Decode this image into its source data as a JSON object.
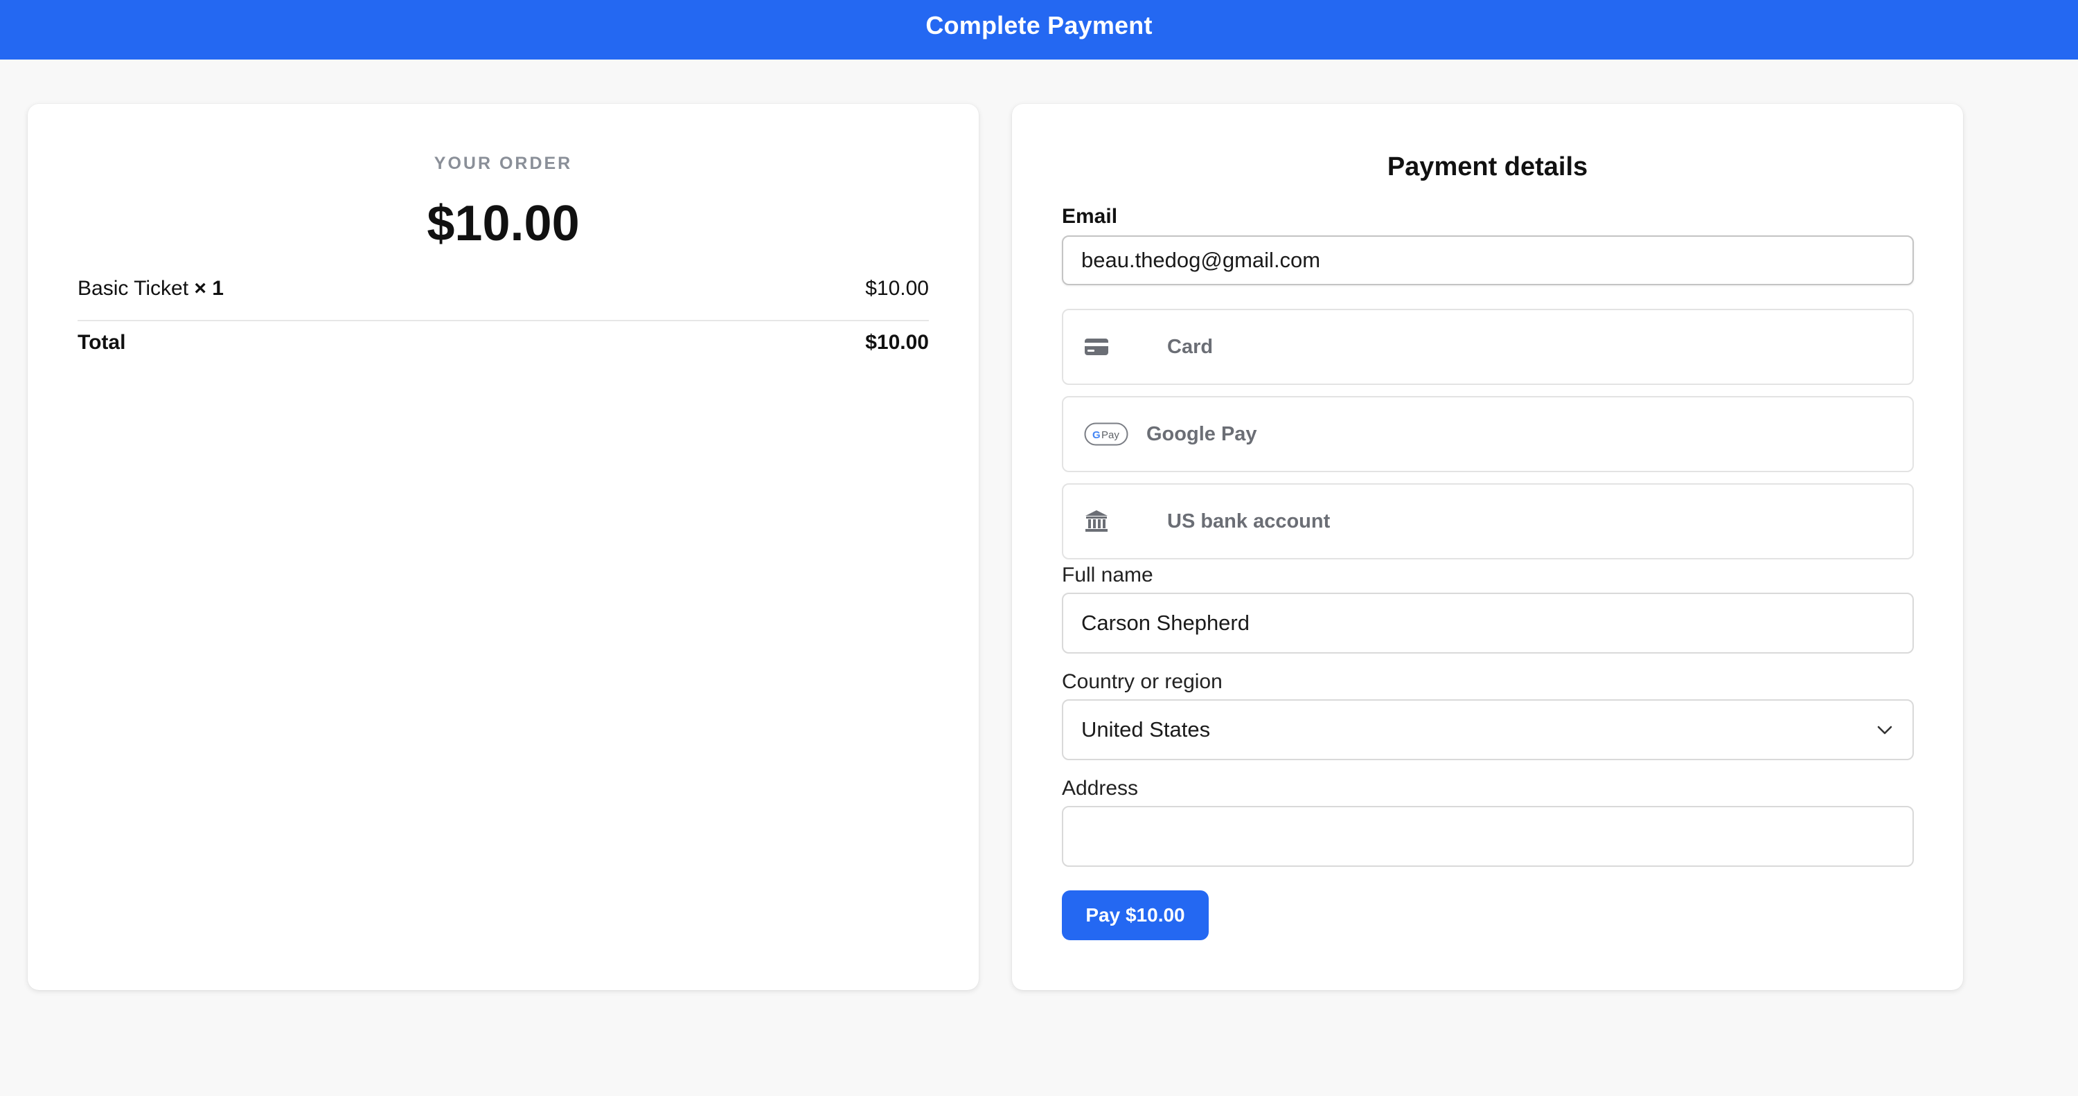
{
  "header": {
    "title": "Complete Payment"
  },
  "order": {
    "eyebrow": "YOUR ORDER",
    "amount": "$10.00",
    "item": {
      "name": "Basic Ticket",
      "qty": "× 1",
      "price": "$10.00"
    },
    "total": {
      "label": "Total",
      "value": "$10.00"
    }
  },
  "payment": {
    "title": "Payment details",
    "email": {
      "label": "Email",
      "value": "beau.thedog@gmail.com"
    },
    "methods": [
      {
        "label": "Card",
        "icon": "credit-card-icon"
      },
      {
        "label": "Google Pay",
        "icon": "google-pay-icon"
      },
      {
        "label": "US bank account",
        "icon": "bank-icon"
      }
    ],
    "full_name": {
      "label": "Full name",
      "value": "Carson Shepherd"
    },
    "country": {
      "label": "Country or region",
      "value": "United States"
    },
    "address": {
      "label": "Address",
      "value": ""
    },
    "pay_button": "Pay $10.00"
  },
  "colors": {
    "brand": "#2468f2",
    "muted_text": "#6b6e75",
    "page_bg": "#f8f8f8"
  }
}
